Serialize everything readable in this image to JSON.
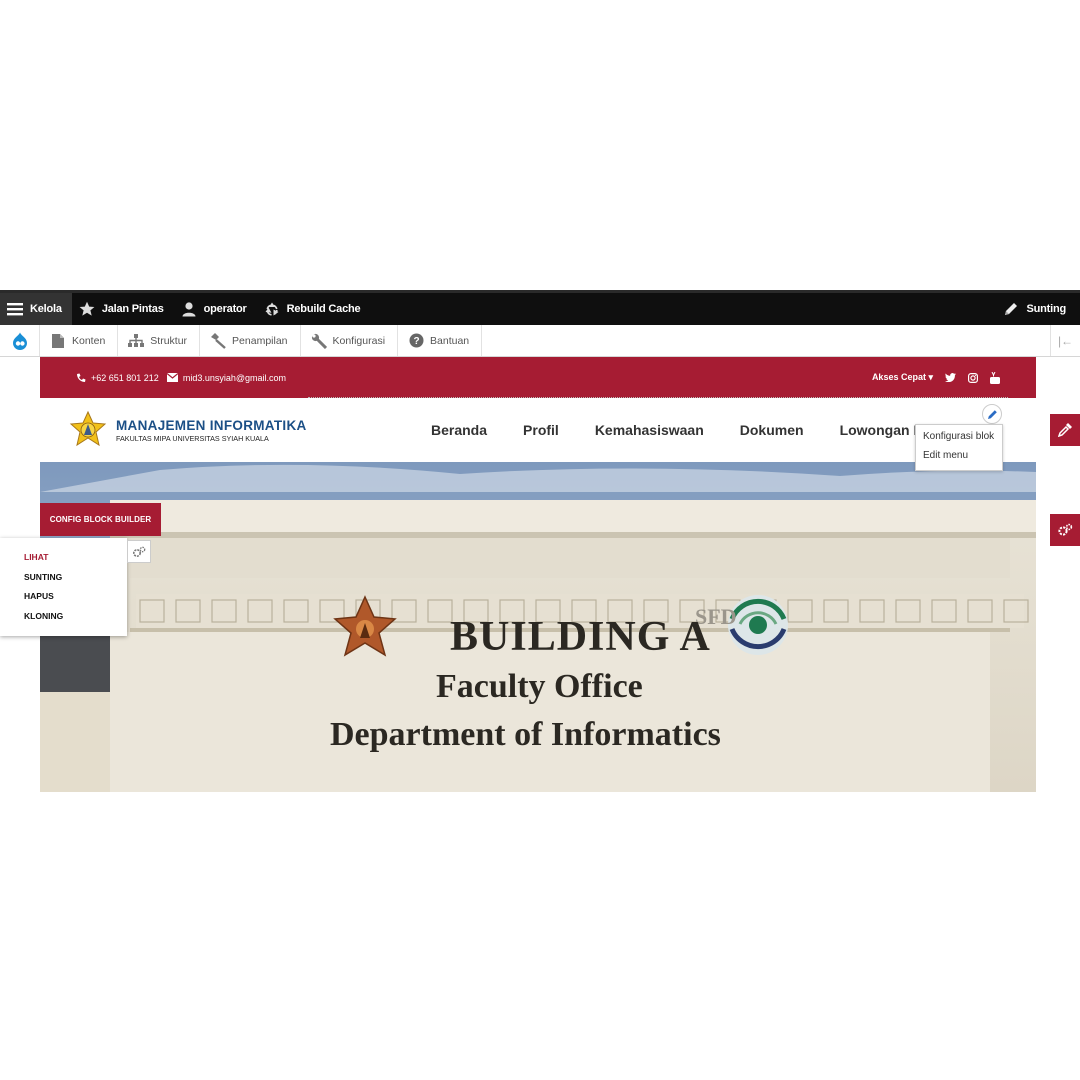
{
  "toolbar": {
    "manage_label": "Kelola",
    "shortcuts_label": "Jalan Pintas",
    "user_label": "operator",
    "rebuild_label": "Rebuild Cache",
    "edit_label": "Sunting"
  },
  "tray": {
    "items": [
      {
        "label": "Konten",
        "icon": "file-icon"
      },
      {
        "label": "Struktur",
        "icon": "structure-icon"
      },
      {
        "label": "Penampilan",
        "icon": "appearance-icon"
      },
      {
        "label": "Konfigurasi",
        "icon": "wrench-icon"
      },
      {
        "label": "Bantuan",
        "icon": "help-icon"
      }
    ]
  },
  "site": {
    "topbar": {
      "phone": "+62 651 801 212",
      "email": "mid3.unsyiah@gmail.com",
      "quick_access": "Akses Cepat"
    },
    "logo": {
      "title": "MANAJEMEN INFORMATIKA",
      "subtitle": "FAKULTAS MIPA UNIVERSITAS SYIAH KUALA"
    },
    "nav": {
      "items": [
        {
          "label": "Beranda"
        },
        {
          "label": "Profil"
        },
        {
          "label": "Kemahasiswaan"
        },
        {
          "label": "Dokumen"
        },
        {
          "label": "Lowongan Pe"
        }
      ]
    },
    "hero": {
      "line1": "BUILDING A",
      "line2": "Faculty Office",
      "line3": "Department of Informatics",
      "badge": "SFD"
    }
  },
  "overlays": {
    "config_block_builder": "CONFIG BLOCK BUILDER",
    "view_menu": [
      "LIHAT",
      "SUNTING",
      "HAPUS",
      "KLONING"
    ],
    "context_menu": [
      "Konfigurasi blok",
      "Edit menu"
    ]
  },
  "colors": {
    "brand_red": "#a61c33",
    "toolbar_black": "#0f0f0f",
    "logo_blue": "#1b4f86"
  }
}
